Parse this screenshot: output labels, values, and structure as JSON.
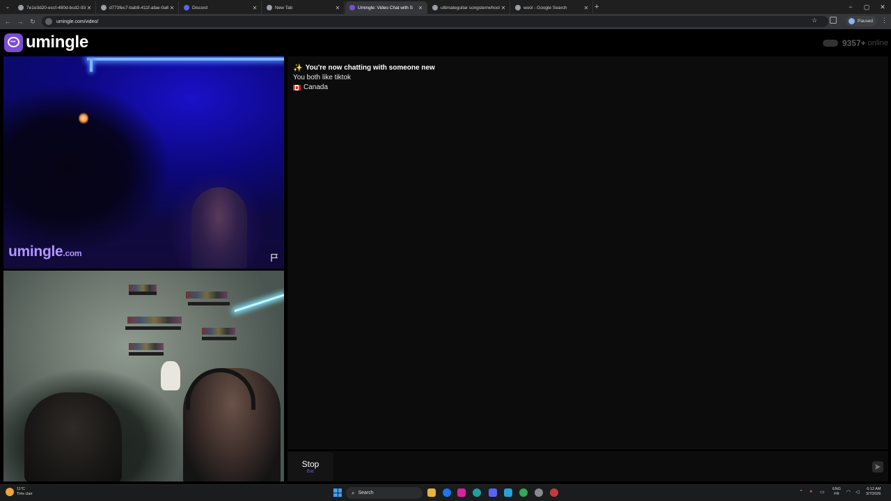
{
  "browser": {
    "tabs": [
      {
        "label": "7e1e3d20-eccf-480d-bcd2-933",
        "active": false,
        "favicon_color": "#9aa0a6"
      },
      {
        "label": "d773fec7-bab9-411f-afae-0a6",
        "active": false,
        "favicon_color": "#9aa0a6"
      },
      {
        "label": "Discord",
        "active": false,
        "favicon_color": "#5865f2"
      },
      {
        "label": "New Tab",
        "active": false,
        "favicon_color": "#9aa0a6"
      },
      {
        "label": "Umingle: Video Chat with S",
        "active": true,
        "favicon_color": "#7b4dd6"
      },
      {
        "label": "ultimateguitar songsterrwhool",
        "active": false,
        "favicon_color": "#9aa0a6"
      },
      {
        "label": "wool - Google Search",
        "active": false,
        "favicon_color": "#9aa0a6"
      }
    ],
    "new_tab": "+",
    "url": "umingle.com/video/",
    "profile_status": "Paused",
    "window_controls": [
      "−",
      "▢",
      "✕"
    ]
  },
  "site": {
    "logo_text": "umingle",
    "online_count": "9357+",
    "online_label": "online",
    "brand_color": "#7b4dd6"
  },
  "remote_video": {
    "watermark_main": "umingle",
    "watermark_suffix": ".com",
    "report_icon": "flag-icon"
  },
  "chat": {
    "messages": [
      {
        "icon": "sparkle",
        "text": "You're now chatting with someone new",
        "bold": true
      },
      {
        "icon": "",
        "text": "You both like tiktok",
        "bold": false
      },
      {
        "icon": "flag-canada",
        "text": "Canada",
        "bold": false
      }
    ],
    "stop_label": "Stop",
    "stop_key": "Esc",
    "input_placeholder": "",
    "send_icon": "send-icon"
  },
  "taskbar": {
    "weather_temp": "11°C",
    "weather_desc": "Très clair",
    "search_label": "Search",
    "lang_top": "ENG",
    "lang_bottom": "FR",
    "time": "6:12 AM",
    "date": "3/7/2026"
  }
}
